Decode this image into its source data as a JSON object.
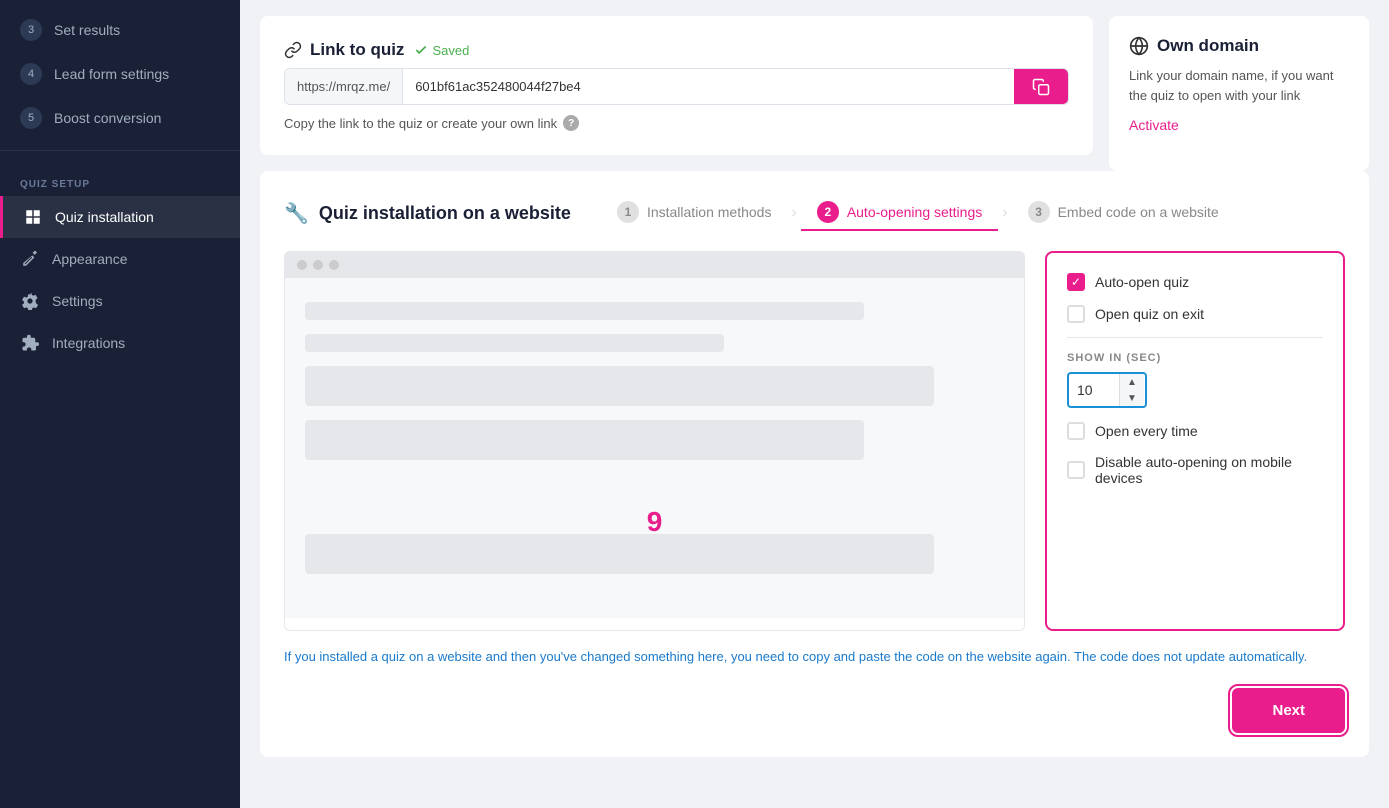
{
  "sidebar": {
    "section_label": "QUIZ SETUP",
    "items": [
      {
        "id": "set-results",
        "step": "3",
        "label": "Set results",
        "active": false
      },
      {
        "id": "lead-form",
        "step": "4",
        "label": "Lead form settings",
        "active": false
      },
      {
        "id": "boost",
        "step": "5",
        "label": "Boost conversion",
        "active": false
      },
      {
        "id": "quiz-installation",
        "label": "Quiz installation",
        "active": true,
        "icon": "grid-icon"
      },
      {
        "id": "appearance",
        "label": "Appearance",
        "active": false,
        "icon": "brush-icon"
      },
      {
        "id": "settings",
        "label": "Settings",
        "active": false,
        "icon": "gear-icon"
      },
      {
        "id": "integrations",
        "label": "Integrations",
        "active": false,
        "icon": "puzzle-icon"
      }
    ]
  },
  "link_section": {
    "title": "Link to quiz",
    "saved_text": "Saved",
    "url_prefix": "https://mrqz.me/",
    "url_value": "601bf61ac352480044f27be4",
    "hint_text": "Copy the link to the quiz or create your own link",
    "copy_icon": "copy-icon"
  },
  "own_domain": {
    "title": "Own domain",
    "globe_icon": "globe-icon",
    "description": "Link your domain name, if you want the quiz to open with your link",
    "activate_label": "Activate"
  },
  "install_section": {
    "title": "Quiz installation on a website",
    "wrench_icon": "wrench-icon",
    "tabs": [
      {
        "num": "1",
        "label": "Installation methods",
        "state": "active"
      },
      {
        "num": "2",
        "label": "Auto-opening settings",
        "state": "current"
      },
      {
        "num": "3",
        "label": "Embed code on a website",
        "state": "inactive"
      }
    ],
    "preview_dots": [
      "dot1",
      "dot2",
      "dot3"
    ],
    "preview_number": "9",
    "options": {
      "auto_open_label": "Auto-open quiz",
      "auto_open_checked": true,
      "open_on_exit_label": "Open quiz on exit",
      "open_on_exit_checked": false,
      "show_in_label": "SHOW IN (SEC)",
      "show_in_value": "10",
      "open_every_time_label": "Open every time",
      "open_every_time_checked": false,
      "disable_mobile_label": "Disable auto-opening on mobile devices",
      "disable_mobile_checked": false
    },
    "info_text": "If you installed a quiz on a website and then you've changed something here, you need to copy and paste the code on the website again. The code does not update automatically.",
    "next_button_label": "Next"
  }
}
